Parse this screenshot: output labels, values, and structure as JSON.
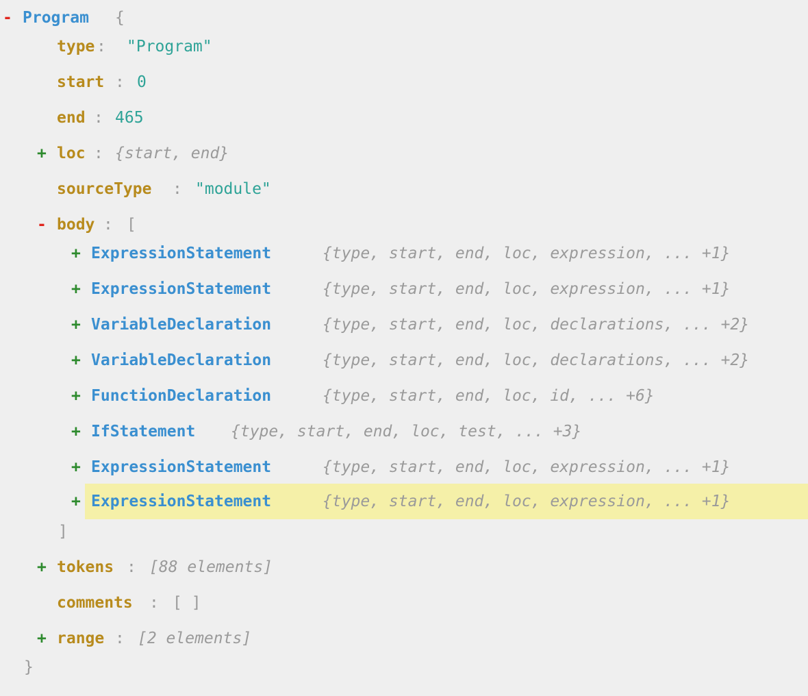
{
  "colors": {
    "background": "#efefef",
    "node_type": "#3a8fd0",
    "key": "#b88b1d",
    "string_value": "#2ea397",
    "collapse_toggle": "#e0261e",
    "expand_toggle": "#2d8a2d",
    "highlight": "#f5f0a8"
  },
  "root": {
    "toggle": "-",
    "label": "Program",
    "open_brace": "{",
    "close_brace": "}"
  },
  "props": {
    "type": {
      "key": "type",
      "colon": ":",
      "value": "\"Program\""
    },
    "start": {
      "key": "start",
      "colon": ":",
      "value": "0"
    },
    "end": {
      "key": "end",
      "colon": ":",
      "value": "465"
    },
    "loc": {
      "toggle": "+",
      "key": "loc",
      "colon": ":",
      "summary": "{start, end}"
    },
    "sourceType": {
      "key": "sourceType",
      "colon": ":",
      "value": "\"module\""
    },
    "body": {
      "toggle": "-",
      "key": "body",
      "colon": ":",
      "open_bracket": "[",
      "close_bracket": "]"
    },
    "tokens": {
      "toggle": "+",
      "key": "tokens",
      "colon": ":",
      "summary": "[88 elements]"
    },
    "comments": {
      "key": "comments",
      "colon": ":",
      "value": "[ ]"
    },
    "range": {
      "toggle": "+",
      "key": "range",
      "colon": ":",
      "summary": "[2 elements]"
    }
  },
  "body_items": [
    {
      "toggle": "+",
      "type": "ExpressionStatement",
      "summary": "{type, start, end, loc, expression, ... +1}"
    },
    {
      "toggle": "+",
      "type": "ExpressionStatement",
      "summary": "{type, start, end, loc, expression, ... +1}"
    },
    {
      "toggle": "+",
      "type": "VariableDeclaration",
      "summary": "{type, start, end, loc, declarations, ... +2}"
    },
    {
      "toggle": "+",
      "type": "VariableDeclaration",
      "summary": "{type, start, end, loc, declarations, ... +2}"
    },
    {
      "toggle": "+",
      "type": "FunctionDeclaration",
      "summary": "{type, start, end, loc, id, ... +6}"
    },
    {
      "toggle": "+",
      "type": "IfStatement",
      "summary": "{type, start, end, loc, test, ... +3}"
    },
    {
      "toggle": "+",
      "type": "ExpressionStatement",
      "summary": "{type, start, end, loc, expression, ... +1}"
    },
    {
      "toggle": "+",
      "type": "ExpressionStatement",
      "summary": "{type, start, end, loc, expression, ... +1}",
      "highlighted": true
    }
  ]
}
